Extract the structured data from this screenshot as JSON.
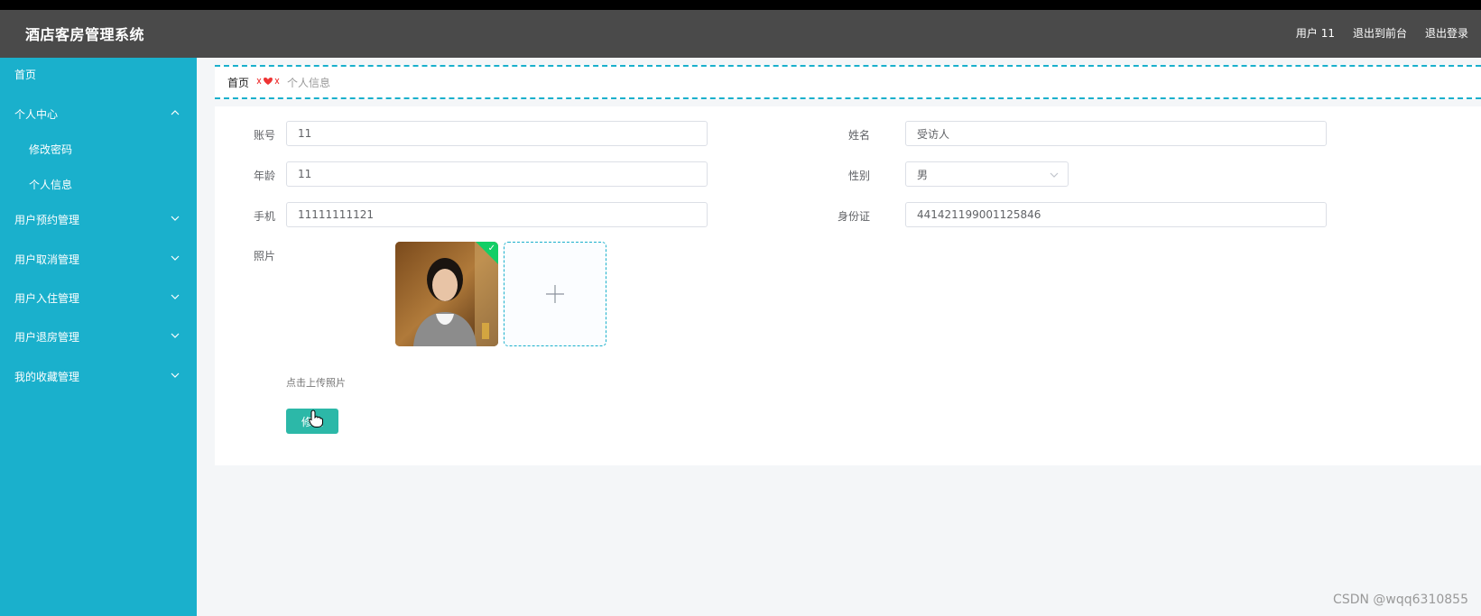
{
  "header": {
    "title": "酒店客房管理系统",
    "user_label": "用户 11",
    "back_front": "退出到前台",
    "logout": "退出登录"
  },
  "sidebar": {
    "items": [
      {
        "label": "首页"
      },
      {
        "label": "个人中心",
        "expanded": true
      },
      {
        "label": "修改密码"
      },
      {
        "label": "个人信息"
      },
      {
        "label": "用户预约管理"
      },
      {
        "label": "用户取消管理"
      },
      {
        "label": "用户入住管理"
      },
      {
        "label": "用户退房管理"
      },
      {
        "label": "我的收藏管理"
      }
    ]
  },
  "breadcrumb": {
    "home": "首页",
    "current": "个人信息"
  },
  "form": {
    "account": {
      "label": "账号",
      "value": "11"
    },
    "name": {
      "label": "姓名",
      "value": "受访人"
    },
    "age": {
      "label": "年龄",
      "value": "11"
    },
    "gender": {
      "label": "性别",
      "value": "男"
    },
    "phone": {
      "label": "手机",
      "value": "11111111121"
    },
    "idcard": {
      "label": "身份证",
      "value": "441421199001125846"
    },
    "photo_label": "照片",
    "upload_hint": "点击上传照片",
    "submit_label": "修改"
  },
  "watermark": "CSDN @wqq6310855",
  "colors": {
    "sidebar": "#1ab0cc",
    "header": "#4a4a4a",
    "button": "#2cb8a8"
  }
}
